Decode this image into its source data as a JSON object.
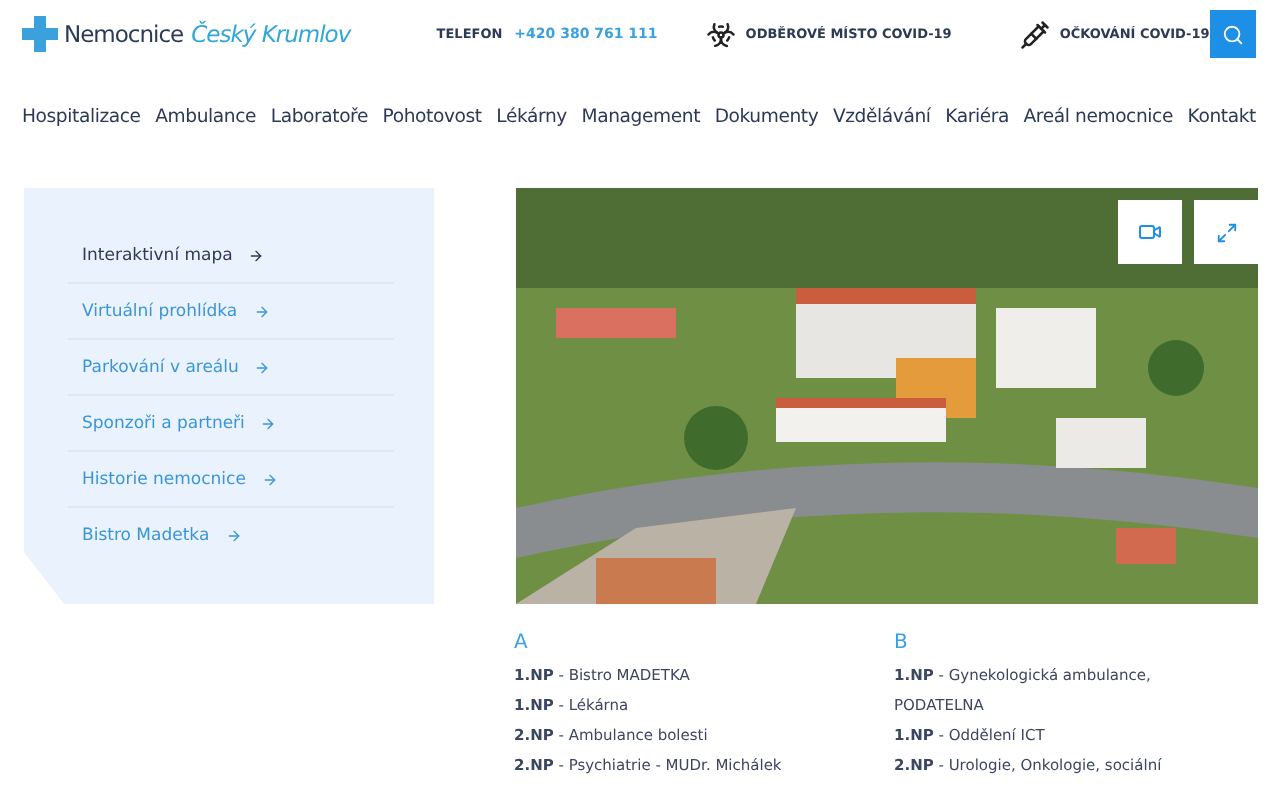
{
  "header": {
    "logo": {
      "name": "Nemocnice",
      "place": "Český Krumlov"
    },
    "phone_label": "TELEFON",
    "phone": "+420 380 761 111",
    "links": [
      {
        "kind": "biohazard",
        "label": "ODBĚROVÉ MÍSTO COVID-19"
      },
      {
        "kind": "syringe",
        "label": "OČKOVÁNÍ COVID-19"
      }
    ]
  },
  "nav": [
    "Hospitalizace",
    "Ambulance",
    "Laboratoře",
    "Pohotovost",
    "Lékárny",
    "Management",
    "Dokumenty",
    "Vzdělávání",
    "Kariéra",
    "Areál nemocnice",
    "Kontakt"
  ],
  "sidebar": {
    "items": [
      {
        "label": "Interaktivní mapa",
        "selected": true
      },
      {
        "label": "Virtuální prohlídka",
        "selected": false
      },
      {
        "label": "Parkování v areálu",
        "selected": false
      },
      {
        "label": "Sponzoři a partneři",
        "selected": false
      },
      {
        "label": "Historie nemocnice",
        "selected": false
      },
      {
        "label": "Bistro Madetka",
        "selected": false
      }
    ]
  },
  "buildings": [
    {
      "letter": "A",
      "rows": [
        "**1.NP** - Bistro MADETKA",
        "**1.NP** - Lékárna",
        "**2.NP** - Ambulance bolesti",
        "**2.NP** - Psychiatrie - MUDr. Michálek"
      ]
    },
    {
      "letter": "B",
      "rows": [
        "**1.NP** - Gynekologická ambulance, PODATELNA",
        "**1.NP** - Oddělení ICT",
        "**2.NP** - Urologie, Onkologie, sociální"
      ]
    }
  ]
}
